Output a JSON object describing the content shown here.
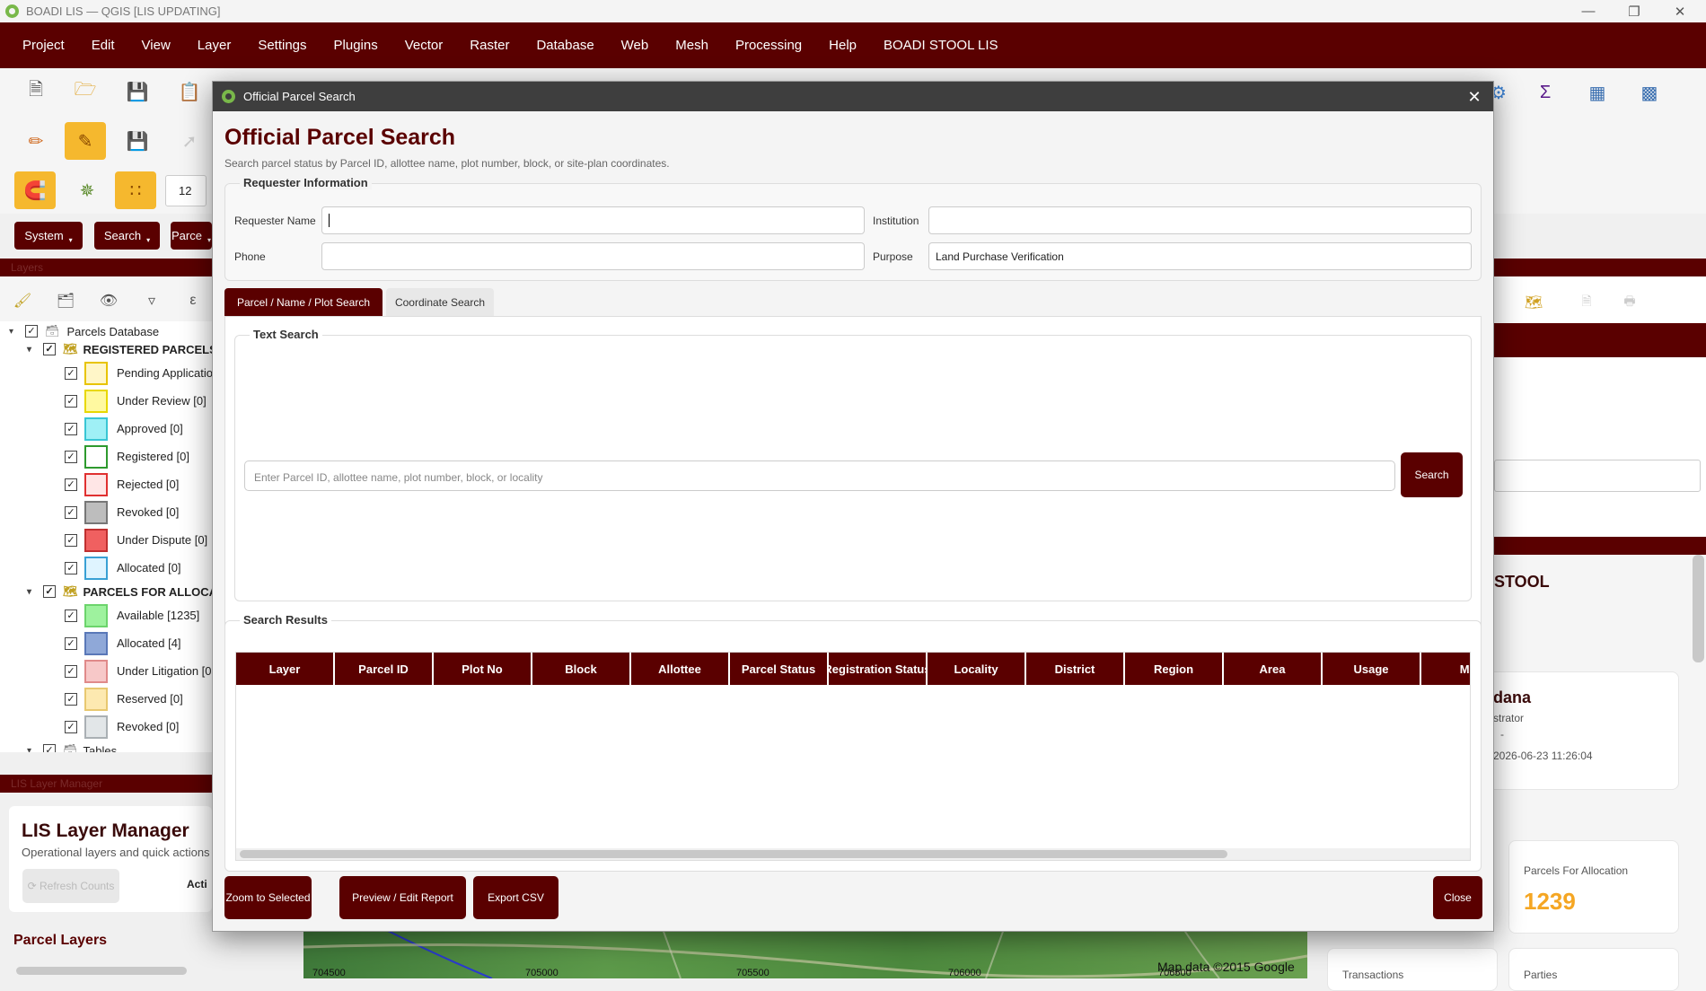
{
  "window": {
    "title": "BOADI LIS — QGIS [LIS UPDATING]"
  },
  "menu": [
    "Project",
    "Edit",
    "View",
    "Layer",
    "Settings",
    "Plugins",
    "Vector",
    "Raster",
    "Database",
    "Web",
    "Mesh",
    "Processing",
    "Help",
    "BOADI STOOL LIS"
  ],
  "toolbar": {
    "scale_value": "12",
    "pills": {
      "system": "System",
      "search": "Search",
      "parcel": "Parce"
    }
  },
  "layers_panel": {
    "header": "Layers",
    "root": "Parcels Database",
    "groups": [
      {
        "label": "REGISTERED PARCELS",
        "items": [
          {
            "label": "Pending Applicatio",
            "fill": "#fff6c8",
            "border": "#e8c400"
          },
          {
            "label": "Under Review [0]",
            "fill": "#fff9a0",
            "border": "#e8d800"
          },
          {
            "label": "Approved [0]",
            "fill": "#9ff0f6",
            "border": "#39c6d4"
          },
          {
            "label": "Registered [0]",
            "fill": "#ffffff",
            "border": "#2e9a2e"
          },
          {
            "label": "Rejected [0]",
            "fill": "#ffe6e6",
            "border": "#e03030"
          },
          {
            "label": "Revoked [0]",
            "fill": "#bdbdbd",
            "border": "#777777"
          },
          {
            "label": "Under Dispute [0]",
            "fill": "#f06060",
            "border": "#c03030"
          },
          {
            "label": "Allocated [0]",
            "fill": "#dff4ff",
            "border": "#39a0d4"
          }
        ]
      },
      {
        "label": "PARCELS FOR ALLOCAT",
        "items": [
          {
            "label": "Available [1235]",
            "fill": "#9ef29e",
            "border": "#6cd46c"
          },
          {
            "label": "Allocated [4]",
            "fill": "#8fa8d8",
            "border": "#5a78b8"
          },
          {
            "label": "Under Litigation [0",
            "fill": "#f7c8c8",
            "border": "#e08a8a"
          },
          {
            "label": "Reserved [0]",
            "fill": "#fde9b0",
            "border": "#e8c870"
          },
          {
            "label": "Revoked [0]",
            "fill": "#e2e6e8",
            "border": "#aab0b4"
          }
        ]
      }
    ],
    "tables_label": "Tables"
  },
  "lis_manager": {
    "header": "LIS Layer Manager",
    "title": "LIS Layer Manager",
    "subtitle": "Operational layers and quick actions",
    "refresh_label": "⟳ Refresh Counts",
    "active_label": "Acti",
    "parcel_layers": "Parcel Layers"
  },
  "right_panel": {
    "stool_title": "STOOL",
    "user_name": "dana",
    "user_role": "strator",
    "dash": "-",
    "timestamp": "2026-06-23 11:26:04",
    "allocation_label": "Parcels For Allocation",
    "allocation_value": "1239",
    "transactions_label": "Transactions",
    "parties_label": "Parties"
  },
  "map": {
    "coords": [
      "704500",
      "705000",
      "705500",
      "706000",
      "706500"
    ],
    "attribution": "Map data ©2015 Google"
  },
  "dialog": {
    "window_title": "Official Parcel Search",
    "heading": "Official Parcel Search",
    "subtitle": "Search parcel status by Parcel ID, allottee name, plot number, block, or site-plan coordinates.",
    "requester": {
      "group_title": "Requester Information",
      "name_label": "Requester Name",
      "name_value": "",
      "institution_label": "Institution",
      "institution_value": "",
      "phone_label": "Phone",
      "phone_value": "",
      "purpose_label": "Purpose",
      "purpose_value": "Land Purchase Verification"
    },
    "tabs": [
      "Parcel / Name / Plot Search",
      "Coordinate Search"
    ],
    "text_search": {
      "group_title": "Text Search",
      "placeholder": "Enter Parcel ID, allottee name, plot number, block, or locality",
      "button": "Search"
    },
    "results": {
      "group_title": "Search Results",
      "columns": [
        "Layer",
        "Parcel ID",
        "Plot No",
        "Block",
        "Allottee",
        "Parcel Status",
        "Registration Status",
        "Locality",
        "District",
        "Region",
        "Area",
        "Usage",
        "Mat"
      ]
    },
    "buttons": {
      "zoom": "Zoom to Selected",
      "preview": "Preview / Edit Report",
      "export": "Export CSV",
      "close": "Close"
    }
  },
  "colors": {
    "brand": "#5a0000",
    "accent_orange": "#f5b82e",
    "allocation_value": "#f5a623"
  }
}
